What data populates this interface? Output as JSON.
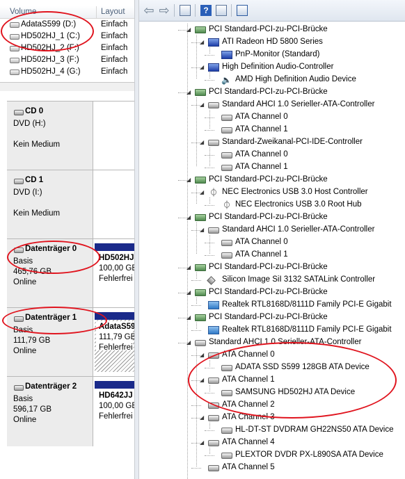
{
  "disk_mgmt": {
    "columns": {
      "volume": "Volume",
      "layout": "Layout"
    },
    "volumes": [
      {
        "name": "AdataS599 (D:)",
        "layout": "Einfach"
      },
      {
        "name": "HD502HJ_1 (C:)",
        "layout": "Einfach"
      },
      {
        "name": "HD502HJ_2 (F:)",
        "layout": "Einfach"
      },
      {
        "name": "HD502HJ_3 (F:)",
        "layout": "Einfach"
      },
      {
        "name": "HD502HJ_4 (G:)",
        "layout": "Einfach"
      }
    ],
    "disks": [
      {
        "title": "CD 0",
        "l1": "DVD (H:)",
        "l2": "Kein Medium"
      },
      {
        "title": "CD 1",
        "l1": "DVD (I:)",
        "l2": "Kein Medium"
      },
      {
        "title": "Datenträger 0",
        "l1": "Basis",
        "l2": "465,76 GB",
        "l3": "Online",
        "part": {
          "name": "HD502HJ",
          "size": "100,00 GB",
          "status": "Fehlerfrei"
        }
      },
      {
        "title": "Datenträger 1",
        "l1": "Basis",
        "l2": "111,79 GB",
        "l3": "Online",
        "part": {
          "name": "AdataS59",
          "size": "111,79 GB",
          "status": "Fehlerfrei"
        }
      },
      {
        "title": "Datenträger 2",
        "l1": "Basis",
        "l2": "596,17 GB",
        "l3": "Online",
        "part": {
          "name": "HD642JJ",
          "size": "100,00 GB",
          "status": "Fehlerfrei"
        }
      }
    ]
  },
  "device_manager": {
    "toolbar": [
      "back-arrow-icon",
      "forward-arrow-icon",
      "show-hide-tree-icon",
      "help-icon",
      "properties-icon",
      "scan-hardware-icon"
    ],
    "tree": [
      {
        "label": "PCI Standard-PCI-zu-PCI-Brücke",
        "level": 0,
        "icon": "board"
      },
      {
        "label": "ATI Radeon HD 5800 Series",
        "level": 1,
        "icon": "display"
      },
      {
        "label": "PnP-Monitor (Standard)",
        "level": 2,
        "icon": "display"
      },
      {
        "label": "High Definition Audio-Controller",
        "level": 1,
        "icon": "display"
      },
      {
        "label": "AMD High Definition Audio Device",
        "level": 2,
        "icon": "speaker"
      },
      {
        "label": "PCI Standard-PCI-zu-PCI-Brücke",
        "level": 0,
        "icon": "board"
      },
      {
        "label": "Standard AHCI 1.0 Serieller-ATA-Controller",
        "level": 1,
        "icon": "drive"
      },
      {
        "label": "ATA Channel 0",
        "level": 2,
        "icon": "drive"
      },
      {
        "label": "ATA Channel 1",
        "level": 2,
        "icon": "drive"
      },
      {
        "label": "Standard-Zweikanal-PCI-IDE-Controller",
        "level": 1,
        "icon": "drive"
      },
      {
        "label": "ATA Channel 0",
        "level": 2,
        "icon": "drive"
      },
      {
        "label": "ATA Channel 1",
        "level": 2,
        "icon": "drive"
      },
      {
        "label": "PCI Standard-PCI-zu-PCI-Brücke",
        "level": 0,
        "icon": "board"
      },
      {
        "label": "NEC Electronics USB 3.0 Host Controller",
        "level": 1,
        "icon": "usb"
      },
      {
        "label": "NEC Electronics USB 3.0 Root Hub",
        "level": 2,
        "icon": "usb"
      },
      {
        "label": "PCI Standard-PCI-zu-PCI-Brücke",
        "level": 0,
        "icon": "board"
      },
      {
        "label": "Standard AHCI 1.0 Serieller-ATA-Controller",
        "level": 1,
        "icon": "drive"
      },
      {
        "label": "ATA Channel 0",
        "level": 2,
        "icon": "drive"
      },
      {
        "label": "ATA Channel 1",
        "level": 2,
        "icon": "drive"
      },
      {
        "label": "PCI Standard-PCI-zu-PCI-Brücke",
        "level": 0,
        "icon": "board"
      },
      {
        "label": "Silicon Image SiI 3132 SATALink Controller",
        "level": 1,
        "icon": "controller"
      },
      {
        "label": "PCI Standard-PCI-zu-PCI-Brücke",
        "level": 0,
        "icon": "board"
      },
      {
        "label": "Realtek RTL8168D/8111D Family PCI-E Gigabit",
        "level": 1,
        "icon": "network"
      },
      {
        "label": "PCI Standard-PCI-zu-PCI-Brücke",
        "level": 0,
        "icon": "board"
      },
      {
        "label": "Realtek RTL8168D/8111D Family PCI-E Gigabit",
        "level": 1,
        "icon": "network"
      },
      {
        "label": "Standard AHCI 1.0 Serieller-ATA-Controller",
        "level": 0,
        "icon": "drive"
      },
      {
        "label": "ATA Channel 0",
        "level": 1,
        "icon": "drive"
      },
      {
        "label": "ADATA SSD S599 128GB ATA Device",
        "level": 2,
        "icon": "drive"
      },
      {
        "label": "ATA Channel 1",
        "level": 1,
        "icon": "drive"
      },
      {
        "label": "SAMSUNG HD502HJ ATA Device",
        "level": 2,
        "icon": "drive"
      },
      {
        "label": "ATA Channel 2",
        "level": 1,
        "icon": "drive"
      },
      {
        "label": "ATA Channel 3",
        "level": 1,
        "icon": "drive"
      },
      {
        "label": "HL-DT-ST DVDRAM GH22NS50 ATA Device",
        "level": 2,
        "icon": "drive"
      },
      {
        "label": "ATA Channel 4",
        "level": 1,
        "icon": "drive"
      },
      {
        "label": "PLEXTOR DVDR   PX-L890SA ATA Device",
        "level": 2,
        "icon": "drive"
      },
      {
        "label": "ATA Channel 5",
        "level": 1,
        "icon": "drive"
      }
    ],
    "highlight_color": "#e0141e"
  }
}
